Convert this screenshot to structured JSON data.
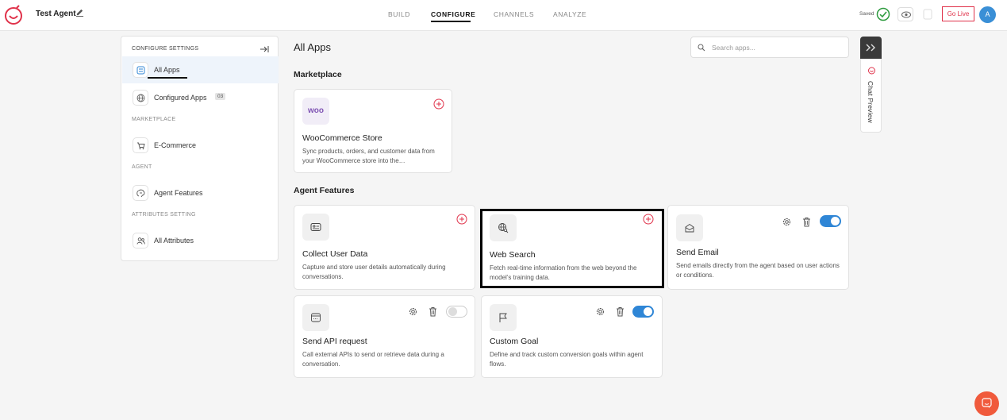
{
  "header": {
    "agent_name": "Test Agent",
    "nav": [
      {
        "label": "BUILD",
        "active": false
      },
      {
        "label": "CONFIGURE",
        "active": true
      },
      {
        "label": "CHANNELS",
        "active": false
      },
      {
        "label": "ANALYZE",
        "active": false
      }
    ],
    "saved_label": "Saved",
    "go_live_label": "Go Live",
    "avatar_initial": "A"
  },
  "sidebar": {
    "title": "CONFIGURE SETTINGS",
    "items": [
      {
        "label": "All Apps",
        "icon": "apps-icon",
        "active": true
      },
      {
        "label": "Configured Apps",
        "icon": "globe-icon",
        "badge": "03"
      },
      {
        "label": "E-Commerce",
        "icon": "cart-icon"
      },
      {
        "label": "Agent Features",
        "icon": "brain-icon"
      },
      {
        "label": "All Attributes",
        "icon": "users-icon"
      }
    ],
    "sections": [
      "MARKETPLACE",
      "AGENT",
      "ATTRIBUTES SETTING"
    ]
  },
  "main": {
    "title": "All Apps",
    "search_placeholder": "Search apps...",
    "marketplace_heading": "Marketplace",
    "agent_features_heading": "Agent Features",
    "marketplace_cards": [
      {
        "logo": "woo",
        "title": "WooCommerce Store",
        "desc": "Sync products, orders, and customer data from your WooCommerce store into the…"
      }
    ],
    "feature_cards": [
      {
        "title": "Collect User Data",
        "desc": "Capture and store user details automatically during conversations.",
        "icon": "id-card-icon"
      },
      {
        "title": "Web Search",
        "desc": "Fetch real-time information from the web beyond the model’s training data.",
        "icon": "web-search-icon"
      },
      {
        "title": "Send Email",
        "desc": "Send emails directly from the agent based on user actions or conditions.",
        "icon": "email-icon",
        "enabled": true
      },
      {
        "title": "Send API request",
        "desc": "Call external APIs to send or retrieve data during a conversation.",
        "icon": "api-icon",
        "enabled": false
      },
      {
        "title": "Custom Goal",
        "desc": "Define and track custom conversion goals within agent flows.",
        "icon": "flag-icon",
        "enabled": true
      }
    ]
  },
  "chat_preview": {
    "label": "Chat Preview"
  },
  "colors": {
    "accent": "#2f86d6",
    "brand": "#e0324a",
    "fab": "#f05a3c"
  }
}
